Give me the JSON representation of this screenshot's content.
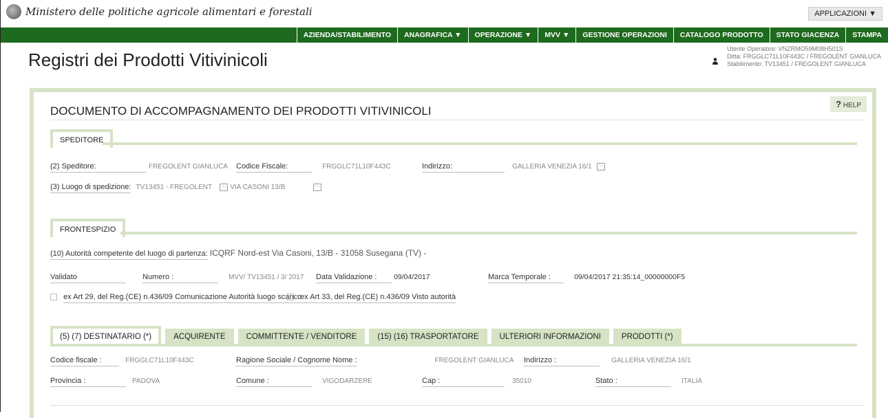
{
  "header": {
    "ministry_name": "Ministero delle politiche agricole alimentari e forestali",
    "apps_label": "APPLICAZIONI ▼"
  },
  "nav": {
    "items": [
      "AZIENDA/STABILIMENTO",
      "ANAGRAFICA ▼",
      "OPERAZIONE ▼",
      "MVV ▼",
      "GESTIONE OPERAZIONI",
      "CATALOGO PRODOTTO",
      "STATO GIACENZA",
      "STAMPA"
    ]
  },
  "page": {
    "title": "Registri dei Prodotti Vitivinicoli"
  },
  "user": {
    "operator": "Utente Operatore: VNZRMO59M08H501S",
    "ditta": "Ditta: FRGGLC71L10F443C / FREGOLENT GIANLUCA",
    "stabilimento": "Stabilimento: TV13451 / FREGOLENT GIANLUCA"
  },
  "help_label": "HELP",
  "doc_title": "DOCUMENTO DI ACCOMPAGNAMENTO DEI PRODOTTI VITIVINICOLI",
  "speditore": {
    "tab": "SPEDITORE",
    "speditore_label": "(2) Speditore:",
    "speditore_value": "FREGOLENT GIANLUCA",
    "cf_label": "Codice Fiscale:",
    "cf_value": "FRGGLC71L10F443C",
    "indirizzo_label": "Indirizzo:",
    "indirizzo_value": "GALLERIA VENEZIA 16/1",
    "luogo_label": "(3) Luogo di spedizione:",
    "luogo_value": "TV13451 - FREGOLENT",
    "luogo_addr": "VIA CASONI 13/B"
  },
  "frontespizio": {
    "tab": "FRONTESPIZIO",
    "autorita_label": "(10) Autorità competente del luogo di partenza:",
    "autorita_value": "ICQRF Nord-est Via Casoni, 13/B - 31058 Susegana (TV)  -",
    "validato_label": "Validato",
    "numero_label": "Numero :",
    "numero_value": "MVV/ TV13451 / 3/ 2017",
    "data_val_label": "Data Validazione :",
    "data_val_value": "09/04/2017",
    "marca_label": "Marca Temporale :",
    "marca_value": "09/04/2017 21:35:14_00000000F5",
    "check1": "ex Art 29, del Reg.(CE) n.436/09 Comunicazione Autorità luogo scarico",
    "check2": "ex Art 33, del Reg.(CE) n.436/09 Visto autorità"
  },
  "tabs": [
    "(5) (7) DESTINATARIO (*)",
    "ACQUIRENTE",
    "COMMITTENTE / VENDITORE",
    "(15) (16) TRASPORTATORE",
    "ULTERIORI INFORMAZIONI",
    "PRODOTTI (*)"
  ],
  "destinatario": {
    "cf_label": "Codice fiscale :",
    "cf_value": "FRGGLC71L10F443C",
    "ragione_label": "Ragione Sociale / Cognome Nome :",
    "ragione_value": "FREGOLENT GIANLUCA",
    "indirizzo_label": "Indirizzo :",
    "indirizzo_value": "GALLERIA VENEZIA 16/1",
    "provincia_label": "Provincia :",
    "provincia_value": "PADOVA",
    "comune_label": "Comune :",
    "comune_value": "VIGODARZERE",
    "cap_label": "Cap :",
    "cap_value": "35010",
    "stato_label": "Stato :",
    "stato_value": "ITALIA"
  }
}
